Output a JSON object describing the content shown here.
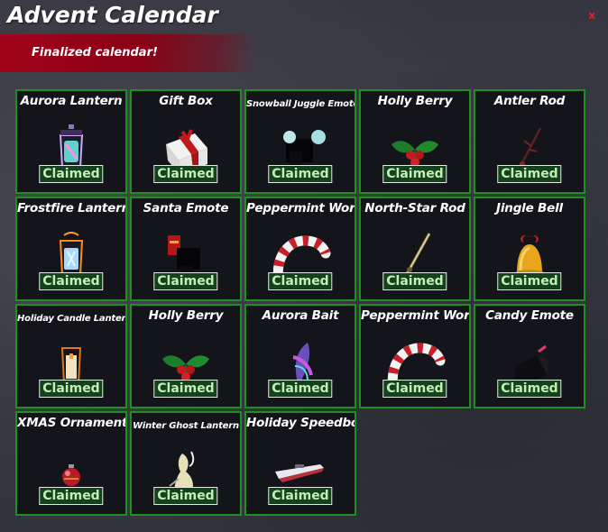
{
  "window": {
    "title": "Advent Calendar",
    "close_label": "x"
  },
  "banner": {
    "text": "Finalized calendar!"
  },
  "tiles": [
    {
      "name": "Aurora Lantern",
      "status": "Claimed",
      "icon": "aurora-lantern-icon"
    },
    {
      "name": "Gift Box",
      "status": "Claimed",
      "icon": "gift-box-icon"
    },
    {
      "name": "Snowball Juggle Emote",
      "status": "Claimed",
      "icon": "snowball-emote-icon"
    },
    {
      "name": "Holly Berry",
      "status": "Claimed",
      "icon": "holly-berry-icon"
    },
    {
      "name": "Antler Rod",
      "status": "Claimed",
      "icon": "antler-rod-icon"
    },
    {
      "name": "Frostfire Lantern",
      "status": "Claimed",
      "icon": "frostfire-lantern-icon"
    },
    {
      "name": "Santa Emote",
      "status": "Claimed",
      "icon": "santa-emote-icon"
    },
    {
      "name": "Peppermint Worm",
      "status": "Claimed",
      "icon": "peppermint-worm-icon"
    },
    {
      "name": "North-Star Rod",
      "status": "Claimed",
      "icon": "north-star-rod-icon"
    },
    {
      "name": "Jingle Bell",
      "status": "Claimed",
      "icon": "jingle-bell-icon"
    },
    {
      "name": "Holiday Candle Lantern",
      "status": "Claimed",
      "icon": "candle-lantern-icon"
    },
    {
      "name": "Holly Berry",
      "status": "Claimed",
      "icon": "holly-berry-icon"
    },
    {
      "name": "Aurora Bait",
      "status": "Claimed",
      "icon": "aurora-bait-icon"
    },
    {
      "name": "Peppermint Worm",
      "status": "Claimed",
      "icon": "peppermint-worm-icon"
    },
    {
      "name": "Candy Emote",
      "status": "Claimed",
      "icon": "candy-emote-icon"
    },
    {
      "name": "XMAS Ornament",
      "status": "Claimed",
      "icon": "ornament-icon"
    },
    {
      "name": "Winter Ghost Lantern",
      "status": "Claimed",
      "icon": "ghost-lantern-icon"
    },
    {
      "name": "Holiday Speedboat",
      "status": "Claimed",
      "icon": "speedboat-icon"
    }
  ],
  "colors": {
    "tile_border": "#1f8f1f",
    "tile_bg": "#14141b",
    "claimed_bg": "#15421d",
    "claimed_text": "#bff0b6",
    "banner": "#a2031a",
    "close": "#e02222"
  }
}
